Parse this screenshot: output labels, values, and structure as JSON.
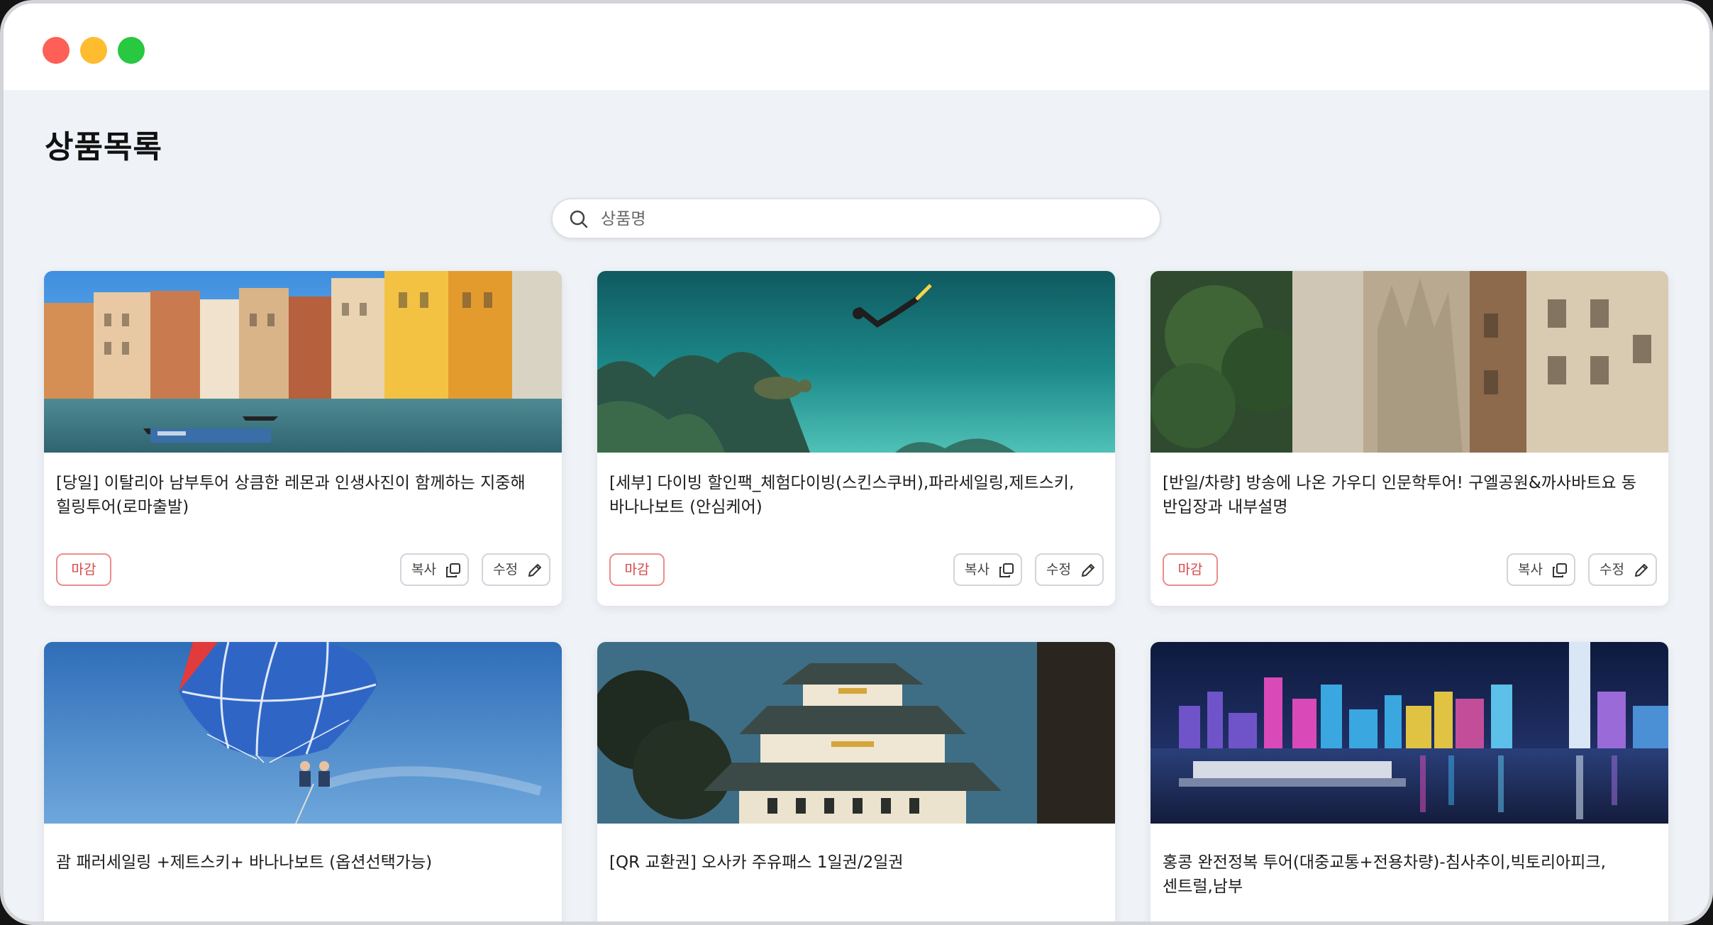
{
  "window": {
    "controls": [
      "close",
      "minimize",
      "maximize"
    ]
  },
  "page": {
    "title": "상품목록"
  },
  "search": {
    "placeholder": "상품명",
    "icon": "search-icon"
  },
  "products": [
    {
      "title": "[당일] 이탈리아 남부투어 상큼한 레몬과 인생사진이 함께하는 지중해 힐링투어(로마출발)",
      "status": "마감",
      "copy_label": "복사",
      "edit_label": "수정",
      "image": "venice-canal"
    },
    {
      "title": "[세부] 다이빙 할인팩_체험다이빙(스킨스쿠버),파라세일링,제트스키, 바나나보트 (안심케어)",
      "status": "마감",
      "copy_label": "복사",
      "edit_label": "수정",
      "image": "underwater-diver"
    },
    {
      "title": "[반일/차량] 방송에 나온 가우디 인문학투어! 구엘공원&까사바트요 동 반입장과 내부설명",
      "status": "마감",
      "copy_label": "복사",
      "edit_label": "수정",
      "image": "barcelona-street"
    },
    {
      "title": "괌 패러세일링 +제트스키+ 바나나보트 (옵션선택가능)",
      "image": "parasailing"
    },
    {
      "title": "[QR 교환권] 오사카 주유패스 1일권/2일권",
      "image": "osaka-castle"
    },
    {
      "title": "홍콩 완전정복 투어(대중교통+전용차량)-침사추이,빅토리아피크,센트럴,남부",
      "image": "hongkong-night"
    }
  ],
  "colors": {
    "background": "#eff2f7",
    "badge_text": "#d54848",
    "badge_border": "#ec8d8d"
  }
}
